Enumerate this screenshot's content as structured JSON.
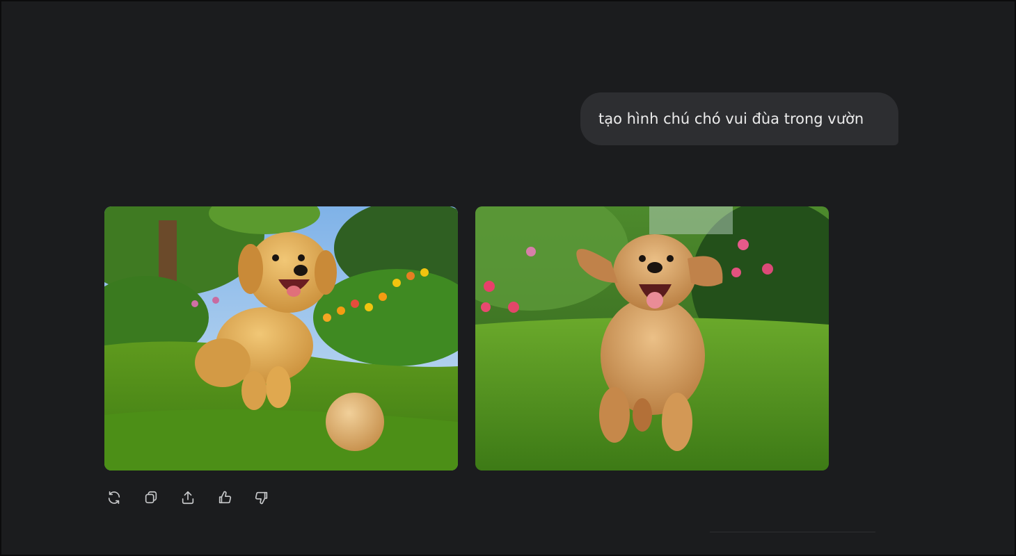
{
  "conversation": {
    "user_message": "tạo hình chú chó vui đùa trong vườn"
  },
  "generated_images": [
    {
      "subject": "golden-retriever-puppy-with-ball"
    },
    {
      "subject": "golden-retriever-running-in-garden"
    }
  ],
  "actions": [
    {
      "name": "regenerate",
      "icon": "refresh-icon"
    },
    {
      "name": "copy",
      "icon": "copy-icon"
    },
    {
      "name": "share",
      "icon": "share-icon"
    },
    {
      "name": "like",
      "icon": "thumbs-up-icon"
    },
    {
      "name": "dislike",
      "icon": "thumbs-down-icon"
    }
  ],
  "colors": {
    "background": "#1b1c1e",
    "bubble": "#2d2e31",
    "text": "#ececec",
    "icon": "#c9cacc"
  }
}
